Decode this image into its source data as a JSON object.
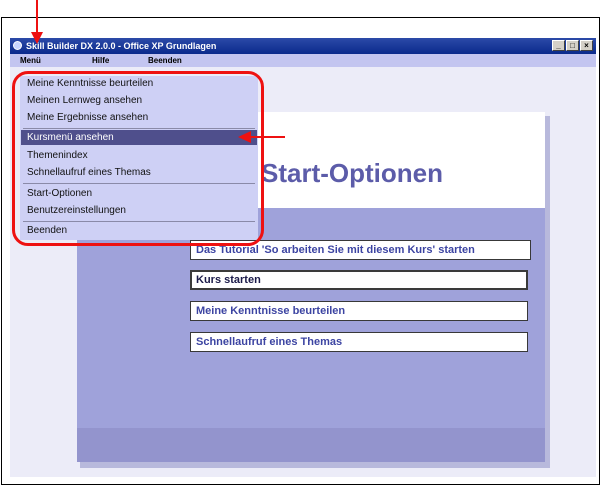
{
  "window": {
    "title": "Skill Builder DX 2.0.0 - Office XP Grundlagen",
    "controls": [
      "_",
      "□",
      "×"
    ]
  },
  "menubar": [
    "Menü",
    "Hilfe",
    "Beenden"
  ],
  "dropdown": {
    "group1": [
      "Meine Kenntnisse beurteilen",
      "Meinen Lernweg ansehen",
      "Meine Ergebnisse ansehen"
    ],
    "group2": [
      "Kursmenü ansehen",
      "Themenindex",
      "Schnellaufruf eines Themas"
    ],
    "group3": [
      "Start-Optionen",
      "Benutzereinstellungen"
    ],
    "group4": [
      "Beenden"
    ],
    "selected": "Kursmenü ansehen"
  },
  "start_options": {
    "heading": "Start-Optionen",
    "buttons": [
      "Das Tutorial 'So arbeiten Sie mit diesem Kurs' starten",
      "Kurs starten",
      "Meine Kenntnisse beurteilen",
      "Schnellaufruf eines Themas"
    ]
  },
  "colors": {
    "annotation": "#ee1111",
    "titlebar": "#0a2a8c",
    "menu_selected": "#4f4f8c",
    "heading": "#5c5ca9"
  }
}
